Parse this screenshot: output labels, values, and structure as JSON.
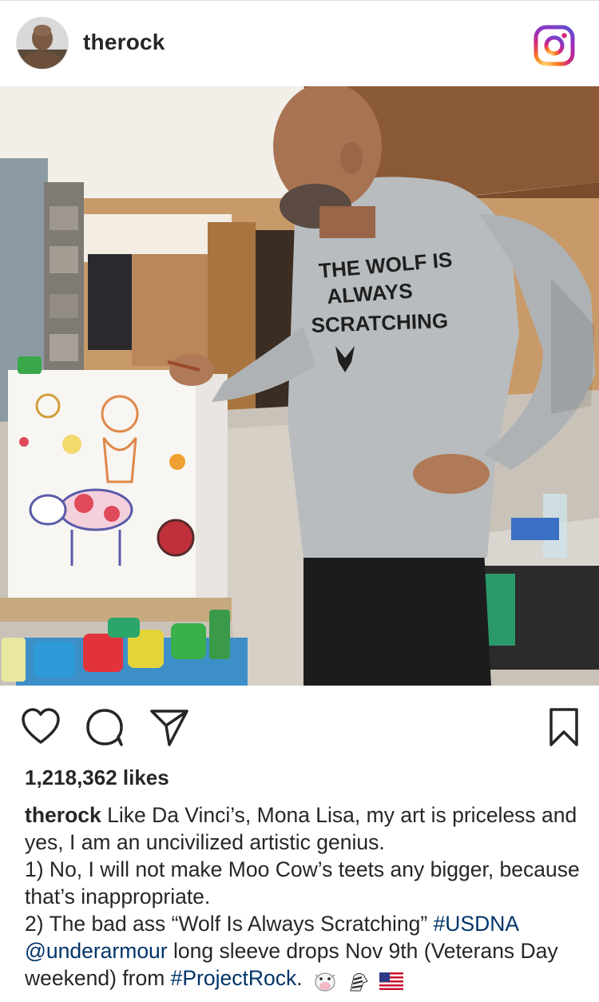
{
  "header": {
    "username": "therock",
    "avatar_icon": "profile-avatar",
    "logo_icon": "instagram-icon",
    "brand_gradient": [
      "#feda75",
      "#fa7e1e",
      "#d62976",
      "#962fbf",
      "#4f5bd5"
    ]
  },
  "photo": {
    "description_icon": "post-photo",
    "shirt_text_line1": "THE WOLF IS",
    "shirt_text_line2": "ALWAYS",
    "shirt_text_line3": "SCRATCHING"
  },
  "actions": {
    "like_icon": "heart-icon",
    "comment_icon": "comment-icon",
    "share_icon": "share-icon",
    "save_icon": "bookmark-icon"
  },
  "likes_text": "1,218,362 likes",
  "caption": {
    "username": "therock",
    "line1": " Like Da Vinci’s, Mona Lisa, my art is priceless and yes, I am an uncivilized artistic genius.",
    "line2": "1) No, I will not make Moo Cow’s teets any bigger, because that’s inappropriate.",
    "line3_pre": "2) The bad ass “Wolf Is Always Scratching” ",
    "hashtag1": "#USDNA",
    "mention": "@underarmour",
    "line3_mid": " long sleeve drops Nov 9th (Veterans Day weekend) from ",
    "hashtag2": "#ProjectRock",
    "line3_end": ".",
    "emojis": [
      "cow-emoji",
      "zebra-emoji",
      "us-flag-emoji"
    ],
    "link_color": "#003569"
  }
}
